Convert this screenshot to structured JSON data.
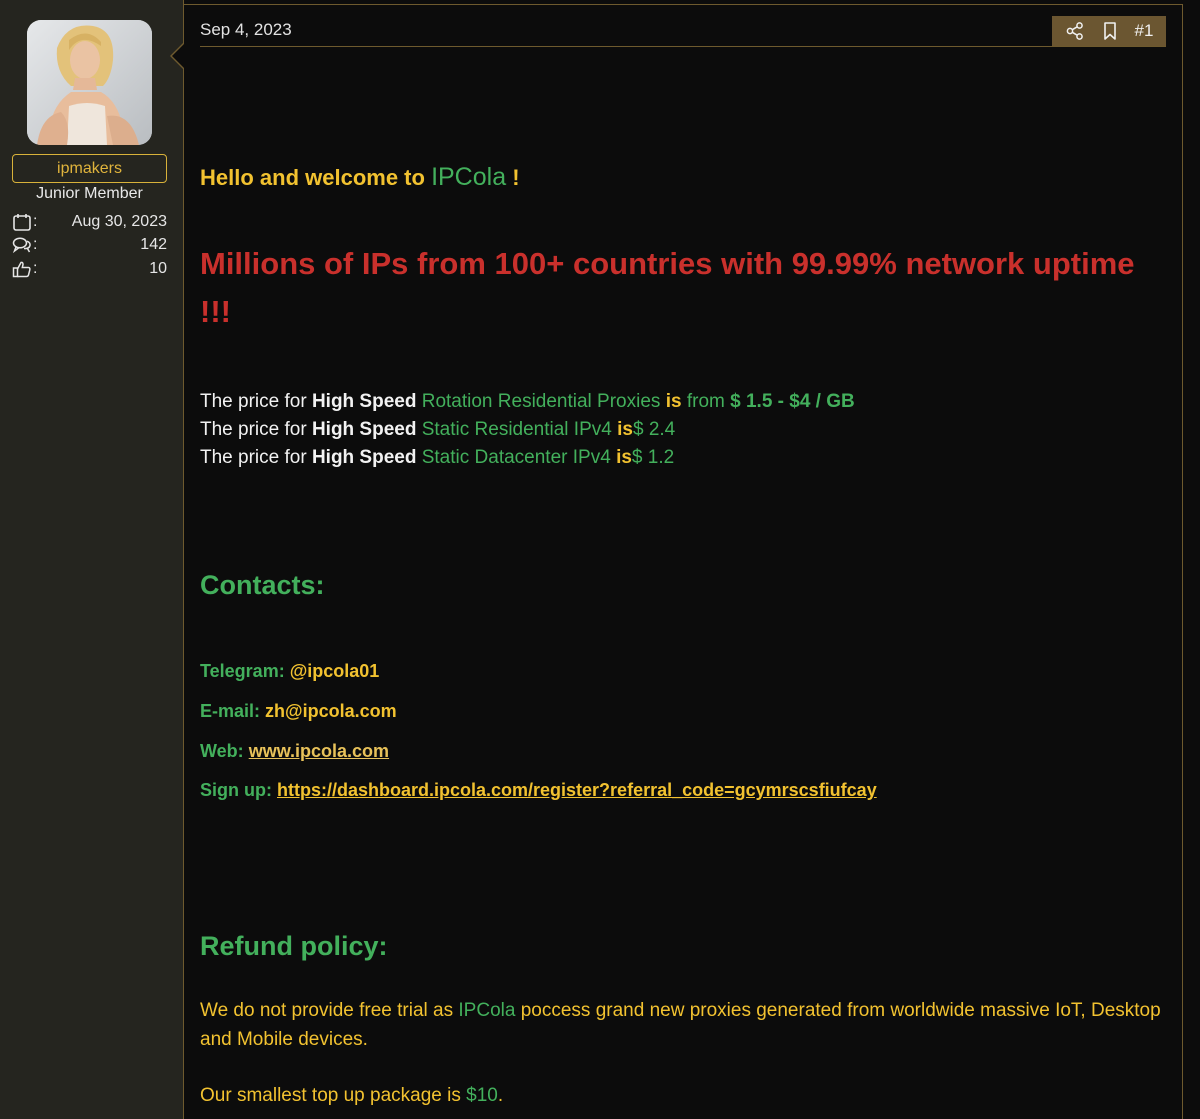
{
  "user": {
    "name": "ipmakers",
    "title": "Junior Member",
    "joined_label_colon": ":",
    "joined": "Aug 30, 2023",
    "messages_colon": ":",
    "messages": "142",
    "reactions_colon": ":",
    "reactions": "10"
  },
  "post": {
    "date": "Sep 4, 2023",
    "number": "#1",
    "welcome_prefix": "Hello and welcome to",
    "brand": "IPCola",
    "welcome_suffix": "!",
    "headline": "Millions of IPs from 100+ countries with 99.99% network uptime !!!",
    "prices": [
      {
        "pre": "The price for",
        "speed": "High Speed",
        "type": "Rotation Residential Proxies",
        "is": "is",
        "from": "from",
        "price": "$ 1.5 - $4 / GB"
      },
      {
        "pre": "The price for",
        "speed": "High Speed",
        "type": "Static Residential IPv4",
        "is": "is",
        "from": "",
        "price": "$ 2.4"
      },
      {
        "pre": "The price for",
        "speed": "High Speed",
        "type": "Static Datacenter IPv4",
        "is": "is",
        "from": "",
        "price": "$ 1.2"
      }
    ],
    "contacts_heading": "Contacts:",
    "contacts": [
      {
        "label": "Telegram:",
        "value": "@ipcola01",
        "link": false
      },
      {
        "label": "E-mail:",
        "value": "zh@ipcola.com",
        "link": false
      },
      {
        "label": "Web:",
        "value": "www.ipcola.com",
        "link": true
      },
      {
        "label": "Sign up:",
        "value": "https://dashboard.ipcola.com/register?referral_code=gcymrscsfiufcay",
        "link": true
      }
    ],
    "refund_heading": "Refund policy:",
    "refund_p1_a": "We do not provide free trial as",
    "refund_p1_brand": "IPCola",
    "refund_p1_b": "poccess grand new proxies generated from worldwide massive IoT, Desktop and Mobile devices.",
    "refund_p2_a": "Our smallest top up package is",
    "refund_p2_amount": "$10",
    "refund_p2_b": "."
  },
  "colors": {
    "accent_gold": "#f2c230",
    "accent_green": "#43b05c",
    "headline_red": "#c9302c",
    "frame_brown": "#6e5a2e",
    "sidebar_bg": "#25251f"
  },
  "icons": [
    "calendar-icon",
    "messages-icon",
    "thumbs-up-icon",
    "share-icon",
    "bookmark-icon"
  ]
}
